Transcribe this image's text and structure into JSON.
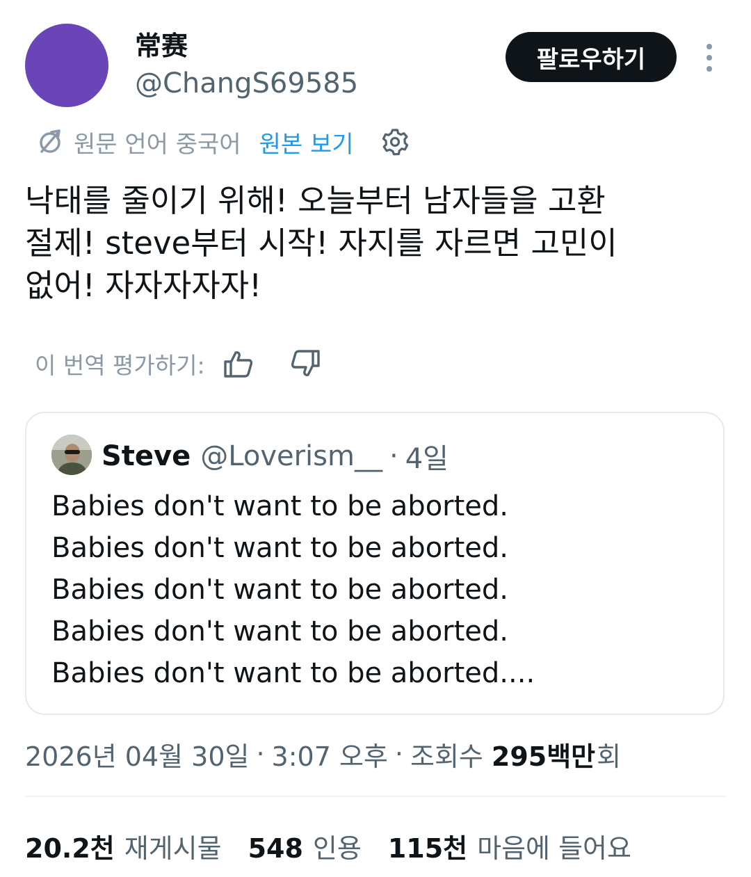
{
  "author": {
    "display_name": "常赛",
    "handle": "@ChangS69585",
    "avatar_color": "#6a45b8"
  },
  "follow_button": {
    "label": "팔로우하기"
  },
  "more_button": {
    "icon": "more-vertical-icon"
  },
  "translation": {
    "icon": "translate-icon",
    "source_language_text": "원문 언어 중국어",
    "view_original_label": "원본 보기",
    "settings_icon": "gear-icon"
  },
  "tweet": {
    "text": "낙태를 줄이기 위해! 오늘부터 남자들을 고환\n절제! steve부터 시작! 자지를 자르면 고민이\n없어! 자자자자자!"
  },
  "rating": {
    "label": "이 번역 평가하기:",
    "up_icon": "thumbs-up-icon",
    "down_icon": "thumbs-down-icon"
  },
  "quoted_tweet": {
    "name": "Steve",
    "handle": "@Loverism__",
    "separator": "·",
    "time": "4일",
    "text": "Babies don't want to be aborted.\nBabies don't want to be aborted.\nBabies don't want to be aborted.\nBabies don't want to be aborted.\nBabies don't want to be aborted...."
  },
  "meta": {
    "date": "2026년 04월 30일",
    "separator": "·",
    "time": "3:07 오후",
    "views_label": "조회수",
    "views_number": "295백만",
    "views_suffix": "회"
  },
  "stats": [
    {
      "number": "20.2천",
      "label": "재게시물"
    },
    {
      "number": "548",
      "label": "인용"
    },
    {
      "number": "115천",
      "label": "마음에 들어요"
    }
  ],
  "colors": {
    "text_primary": "#0f1419",
    "text_secondary": "#536471",
    "link_blue": "#1d9bf0",
    "button_dark": "#0f1419"
  }
}
